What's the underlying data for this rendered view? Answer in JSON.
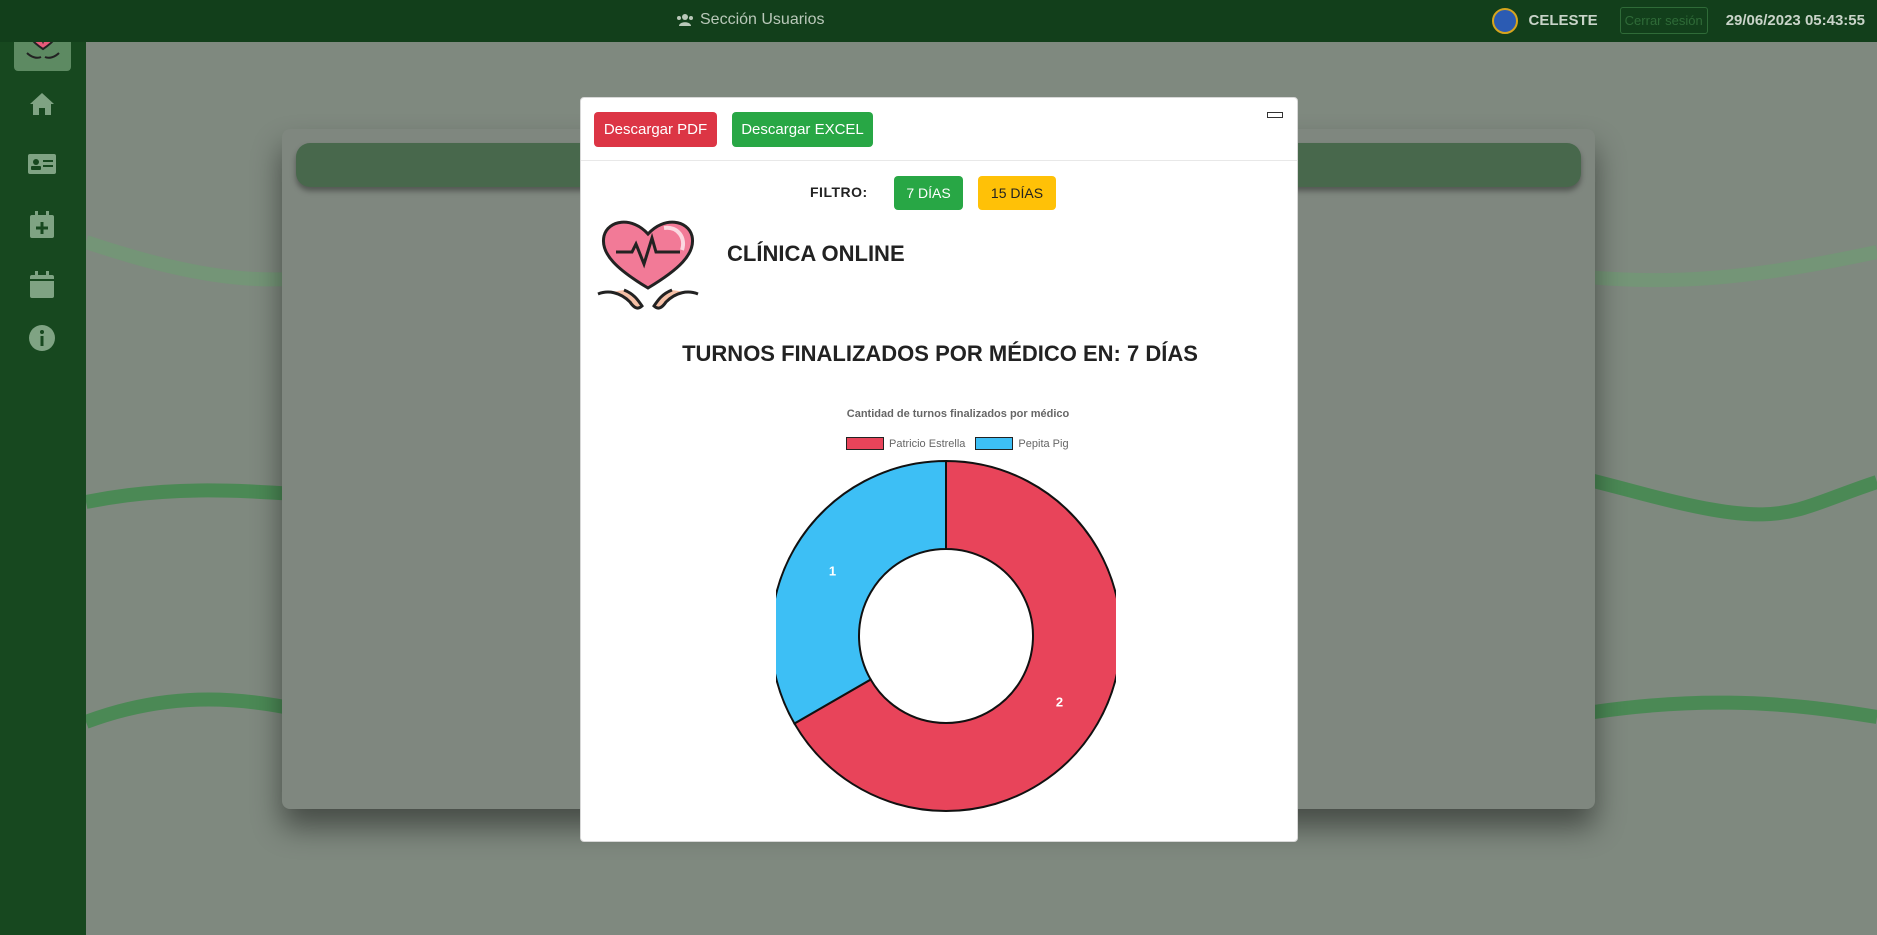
{
  "topbar": {
    "section_title": "Sección Usuarios",
    "section_icon": "users-icon",
    "user_name": "CELESTE",
    "logout_label": "Cerrar sesión",
    "datetime": "29/06/2023 05:43:55"
  },
  "sidebar": {
    "items": [
      {
        "icon": "home-icon"
      },
      {
        "icon": "id-card-icon"
      },
      {
        "icon": "calendar-plus-icon"
      },
      {
        "icon": "calendar-icon"
      },
      {
        "icon": "info-icon"
      }
    ]
  },
  "modal": {
    "pdf_label": "Descargar PDF",
    "excel_label": "Descargar EXCEL",
    "filter_label": "FILTRO:",
    "filter_7_label": "7 DÍAS",
    "filter_15_label": "15 DÍAS",
    "clinic_name": "CLÍNICA ONLINE",
    "report_title": "TURNOS FINALIZADOS POR MÉDICO EN: 7 DÍAS"
  },
  "colors": {
    "danger": "#dc3545",
    "success": "#28a745",
    "warning": "#ffc107",
    "series_1": "#e8445a",
    "series_2": "#3dbff5"
  },
  "chart_data": {
    "type": "pie",
    "title": "Cantidad de turnos finalizados por médico",
    "categories": [
      "Patricio Estrella",
      "Pepita Pig"
    ],
    "values": [
      2,
      1
    ],
    "colors": [
      "#e8445a",
      "#3dbff5"
    ],
    "legend": "top",
    "donut": true
  }
}
